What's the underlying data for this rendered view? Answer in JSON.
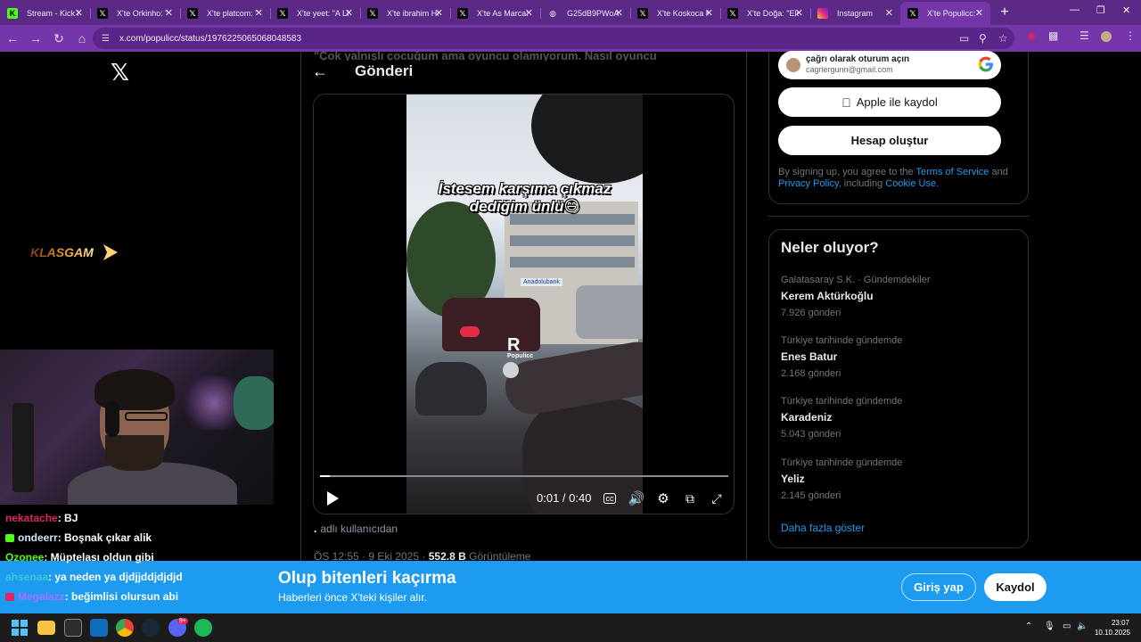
{
  "browser": {
    "tabs": [
      {
        "label": "Stream - Kick D",
        "favicon": "kick-icon",
        "color": "#53fc18",
        "active": false
      },
      {
        "label": "X'te Orkinho: \"",
        "favicon": "x-icon",
        "color": "#000000",
        "active": false
      },
      {
        "label": "X'te platcom: \"",
        "favicon": "x-icon",
        "color": "#000000",
        "active": false
      },
      {
        "label": "X'te yeet: \"A LE",
        "favicon": "x-icon",
        "color": "#000000",
        "active": false
      },
      {
        "label": "X'te ibrahim Ha",
        "favicon": "x-icon",
        "color": "#000000",
        "active": false
      },
      {
        "label": "X'te As Marca: ",
        "favicon": "x-icon",
        "color": "#000000",
        "active": false
      },
      {
        "label": "G25dB9PWoAA",
        "favicon": "globe-icon",
        "color": "#5b2a86",
        "active": false
      },
      {
        "label": "X'te Koskoca M",
        "favicon": "x-icon",
        "color": "#000000",
        "active": false
      },
      {
        "label": "X'te Doğa: \"Ele",
        "favicon": "x-icon",
        "color": "#000000",
        "active": false
      },
      {
        "label": "Instagram",
        "favicon": "instagram-icon",
        "color": "#e1306c",
        "active": false
      },
      {
        "label": "X'te Populicc: \"",
        "favicon": "x-icon",
        "color": "#000000",
        "active": true
      }
    ],
    "url": "x.com/populicc/status/1976225065068048583"
  },
  "stream": {
    "logo_text": "KLASGAM",
    "chat": [
      {
        "user": "nekatache",
        "user_color": "#e0245e",
        "message": " : BJ",
        "badge": null
      },
      {
        "user": "ondeerr",
        "user_color": "#cfe3ff",
        "message": " : Boşnak çıkar alik",
        "badge": "#53fc18"
      },
      {
        "user": "Ozonee",
        "user_color": "#53fc18",
        "message": " : Müptelası oldun gibi",
        "badge": null
      },
      {
        "user": "ahsenaa",
        "user_color": "#3ec8d4",
        "message": " : ya neden ya djdjjddjdjdjd",
        "badge": null
      },
      {
        "user": "Megalazz",
        "user_color": "#a970ff",
        "message": " : beğimlisi olursun abi",
        "badge": "#e0245e"
      }
    ]
  },
  "post": {
    "header_title": "Gönderi",
    "hidden_text": "\"Çok yalnışlı çocuğum ama oyuncu olamıyorum. Nasıl oyuncu",
    "video": {
      "caption_line1": "İstesem karşıma çıkmaz",
      "caption_line2": "dediğim ünlü😅",
      "watermark": "Populicc",
      "bank_sign": "Anadolubank",
      "time_current": "0:01",
      "time_separator": " / ",
      "time_total": "0:40",
      "progress_fraction": 0.025
    },
    "alt_prefix": ".",
    "alt_text": "adlı kullanıcıdan",
    "time": "ÖS 12:55 · 9 Eki 2025 · ",
    "views": "552.8 B",
    "views_label": " Görüntüleme"
  },
  "signup": {
    "google_title": "çağrı olarak oturum açın",
    "google_email": "cagriergunn@gmail.com",
    "apple_label": "Apple ile kaydol",
    "create_label": "Hesap oluştur",
    "terms_prefix": "By signing up, you agree to the ",
    "terms_link": "Terms of Service",
    "terms_and": " and",
    "privacy_link": "Privacy Policy",
    "terms_including": ", including ",
    "cookie_link": "Cookie Use",
    "terms_end": "."
  },
  "trends": {
    "title": "Neler oluyor?",
    "items": [
      {
        "category": "Galatasaray S.K. · Gündemdekiler",
        "name": "Kerem Aktürkoğlu",
        "count": "7.926 gönderi"
      },
      {
        "category": "Türkiye tarihinde gündemde",
        "name": "Enes Batur",
        "count": "2.168 gönderi"
      },
      {
        "category": "Türkiye tarihinde gündemde",
        "name": "Karadeniz",
        "count": "5.043 gönderi"
      },
      {
        "category": "Türkiye tarihinde gündemde",
        "name": "Yeliz",
        "count": "2.145 gönderi"
      }
    ],
    "show_more": "Daha fazla göster"
  },
  "banner": {
    "title": "Olup bitenleri kaçırma",
    "subtitle": "Haberleri önce X'teki kişiler alır.",
    "login": "Giriş yap",
    "register": "Kaydol"
  },
  "taskbar": {
    "time": "23:07",
    "date": "10.10.2025",
    "discord_badge": "9+"
  },
  "colors": {
    "x_blue": "#1d9bf0",
    "browser_purple": "#7436a8"
  }
}
